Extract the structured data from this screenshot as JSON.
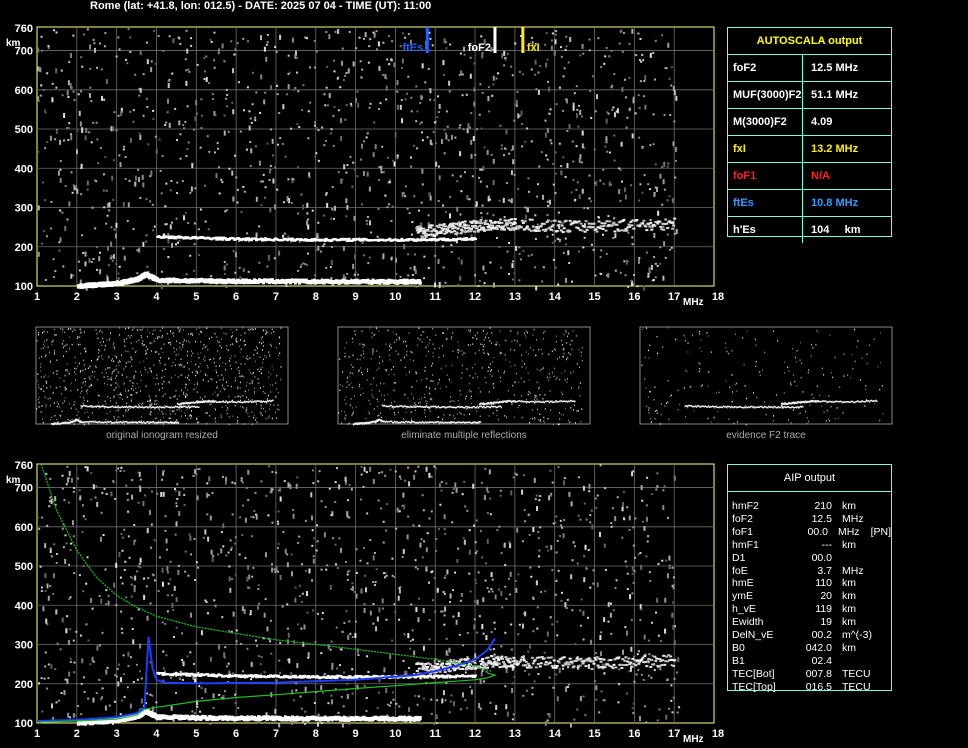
{
  "title": "Rome (lat: +41.8, lon: 012.5) - DATE: 2025 07 04 - TIME (UT): 11:00",
  "axes": {
    "x_ticks": [
      "1",
      "2",
      "3",
      "4",
      "5",
      "6",
      "7",
      "8",
      "9",
      "10",
      "11",
      "12",
      "13",
      "14",
      "15",
      "16",
      "17",
      "18"
    ],
    "y_ticks": [
      "100",
      "200",
      "300",
      "400",
      "500",
      "600",
      "700",
      "760"
    ],
    "x_unit": "MHz",
    "y_unit": "km"
  },
  "markers": [
    {
      "label": "ftEs",
      "freq": 10.8,
      "color": "#1e64ff"
    },
    {
      "label": "foF2",
      "freq": 12.5,
      "color": "#ffffff"
    },
    {
      "label": "fxI",
      "freq": 13.2,
      "color": "#ffee00"
    }
  ],
  "autoscala": {
    "header": "AUTOSCALA output",
    "rows": [
      {
        "key": "foF2",
        "value": "12.5 MHz",
        "color": "#ffffff"
      },
      {
        "key": "MUF(3000)F2",
        "value": "51.1 MHz",
        "color": "#ffffff"
      },
      {
        "key": "M(3000)F2",
        "value": "4.09",
        "color": "#ffffff"
      },
      {
        "key": "fxI",
        "value": "13.2 MHz",
        "color": "#ffee00"
      },
      {
        "key": "foF1",
        "value": "N/A",
        "color": "#ff2020"
      },
      {
        "key": "ftEs",
        "value": "10.8 MHz",
        "color": "#3399ff"
      },
      {
        "key": "h'Es",
        "value": "104     km",
        "color": "#ffffff"
      }
    ]
  },
  "captions": [
    "original ionogram resized",
    "eliminate multiple reflections",
    "evidence F2 trace"
  ],
  "aip": {
    "header": "AIP output",
    "rows": [
      {
        "k": "hmF2",
        "v": "210",
        "u": "km",
        "x": ""
      },
      {
        "k": "foF2",
        "v": "12.5",
        "u": "MHz",
        "x": ""
      },
      {
        "k": "foF1",
        "v": "00.0",
        "u": "MHz",
        "x": "[PN]"
      },
      {
        "k": "hmF1",
        "v": "---",
        "u": "km",
        "x": ""
      },
      {
        "k": "D1",
        "v": "00.0",
        "u": "",
        "x": ""
      },
      {
        "k": "foE",
        "v": "3.7",
        "u": "MHz",
        "x": ""
      },
      {
        "k": "hmE",
        "v": "110",
        "u": "km",
        "x": ""
      },
      {
        "k": "ymE",
        "v": "20",
        "u": "km",
        "x": ""
      },
      {
        "k": "h_vE",
        "v": "119",
        "u": "km",
        "x": ""
      },
      {
        "k": "Ewidth",
        "v": "19",
        "u": "km",
        "x": ""
      },
      {
        "k": "DelN_vE",
        "v": "00.2",
        "u": "m^(-3)",
        "x": ""
      },
      {
        "k": "B0",
        "v": "042.0",
        "u": "km",
        "x": ""
      },
      {
        "k": "B1",
        "v": "02.4",
        "u": "",
        "x": ""
      },
      {
        "k": "TEC[Bot]",
        "v": "007.8",
        "u": "TECU",
        "x": ""
      },
      {
        "k": "TEC[Top]",
        "v": "016.5",
        "u": "TECU",
        "x": ""
      }
    ]
  },
  "chart_data": {
    "type": "scatter",
    "x_range": [
      1,
      18
    ],
    "y_range": [
      100,
      760
    ],
    "grid": true,
    "traces": {
      "E_layer": {
        "x": [
          2.0,
          2.5,
          3.0,
          3.5,
          3.7,
          4.0,
          5.0,
          6.0,
          7.0,
          8.0,
          9.0,
          10.0,
          10.6
        ],
        "y": [
          105,
          108,
          112,
          122,
          135,
          120,
          118,
          117,
          117,
          116,
          116,
          116,
          116
        ]
      },
      "F2_low": {
        "x": [
          4.0,
          5.0,
          6.0,
          7.0,
          8.0,
          9.0,
          10.0,
          11.0,
          12.0
        ],
        "y": [
          228,
          225,
          222,
          221,
          220,
          220,
          220,
          221,
          222
        ]
      },
      "F2_high": {
        "x": [
          10.5,
          11.0,
          11.5,
          12.0,
          12.5,
          13.0,
          14.0,
          15.0,
          16.0,
          17.0
        ],
        "y": [
          240,
          245,
          250,
          255,
          260,
          258,
          255,
          255,
          258,
          262
        ]
      }
    },
    "model_profiles": {
      "blue_profile": {
        "x": [
          1.0,
          2.0,
          3.0,
          3.5,
          3.7,
          3.8,
          3.9,
          4.0,
          4.2,
          5.0,
          7.0,
          9.0,
          10.5,
          11.0,
          11.5,
          12.0,
          12.3,
          12.5
        ],
        "y": [
          105,
          108,
          115,
          125,
          140,
          320,
          240,
          210,
          203,
          201,
          203,
          210,
          222,
          232,
          245,
          262,
          285,
          315
        ]
      },
      "green_upper": {
        "x": [
          1.1,
          1.3,
          1.5,
          2.0,
          2.5,
          3.0,
          3.5,
          4.0,
          5.0,
          6.0,
          7.0,
          8.0,
          9.0,
          10.0,
          11.0,
          12.0,
          12.4
        ],
        "y": [
          760,
          700,
          640,
          540,
          470,
          425,
          395,
          372,
          345,
          328,
          312,
          300,
          288,
          275,
          262,
          245,
          232
        ]
      },
      "green_lower": {
        "x": [
          1.0,
          2.0,
          3.0,
          3.5,
          3.7,
          4.0,
          5.0,
          6.0,
          7.0,
          8.0,
          9.0,
          10.0,
          11.0,
          12.0,
          12.3,
          12.5,
          12.3
        ],
        "y": [
          102,
          105,
          110,
          120,
          135,
          140,
          155,
          165,
          172,
          180,
          188,
          195,
          203,
          210,
          215,
          222,
          228
        ]
      }
    }
  }
}
